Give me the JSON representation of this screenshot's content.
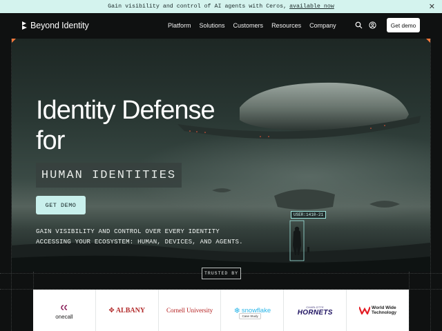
{
  "announcement": {
    "text": "Gain visibility and control of AI agents with Ceros,",
    "link": "available now"
  },
  "nav": {
    "brand": "Beyond Identity",
    "menu": [
      "Platform",
      "Solutions",
      "Customers",
      "Resources",
      "Company"
    ],
    "cta": "Get demo"
  },
  "hero": {
    "title_line1": "Identity Defense",
    "title_line2": "for",
    "rotating_tag": "HUMAN IDENTITIES",
    "cta": "GET DEMO",
    "subtitle_line1": "GAIN VISIBILITY AND CONTROL OVER EVERY IDENTITY",
    "subtitle_line2": "ACCESSING YOUR ECOSYSTEM: HUMAN, DEVICES, AND AGENTS.",
    "user_label": "USER:1410-21"
  },
  "trusted": {
    "label": "TRUSTED BY",
    "logos": [
      {
        "name": "onecall",
        "text": "onecall"
      },
      {
        "name": "albany",
        "text": "ALBANY"
      },
      {
        "name": "cornell",
        "text": "Cornell University"
      },
      {
        "name": "snowflake",
        "text": "snowflake",
        "badge": "Case Study"
      },
      {
        "name": "hornets",
        "text": "HORNETS",
        "small": "CHARLOTTE"
      },
      {
        "name": "wwt",
        "text_line1": "World Wide",
        "text_line2": "Technology"
      }
    ]
  },
  "colors": {
    "announcement_bg": "#d4f3ee",
    "accent_mint": "#c9f0ec",
    "corner_orange": "#ff7a3c",
    "page_bg": "#0f1111"
  }
}
